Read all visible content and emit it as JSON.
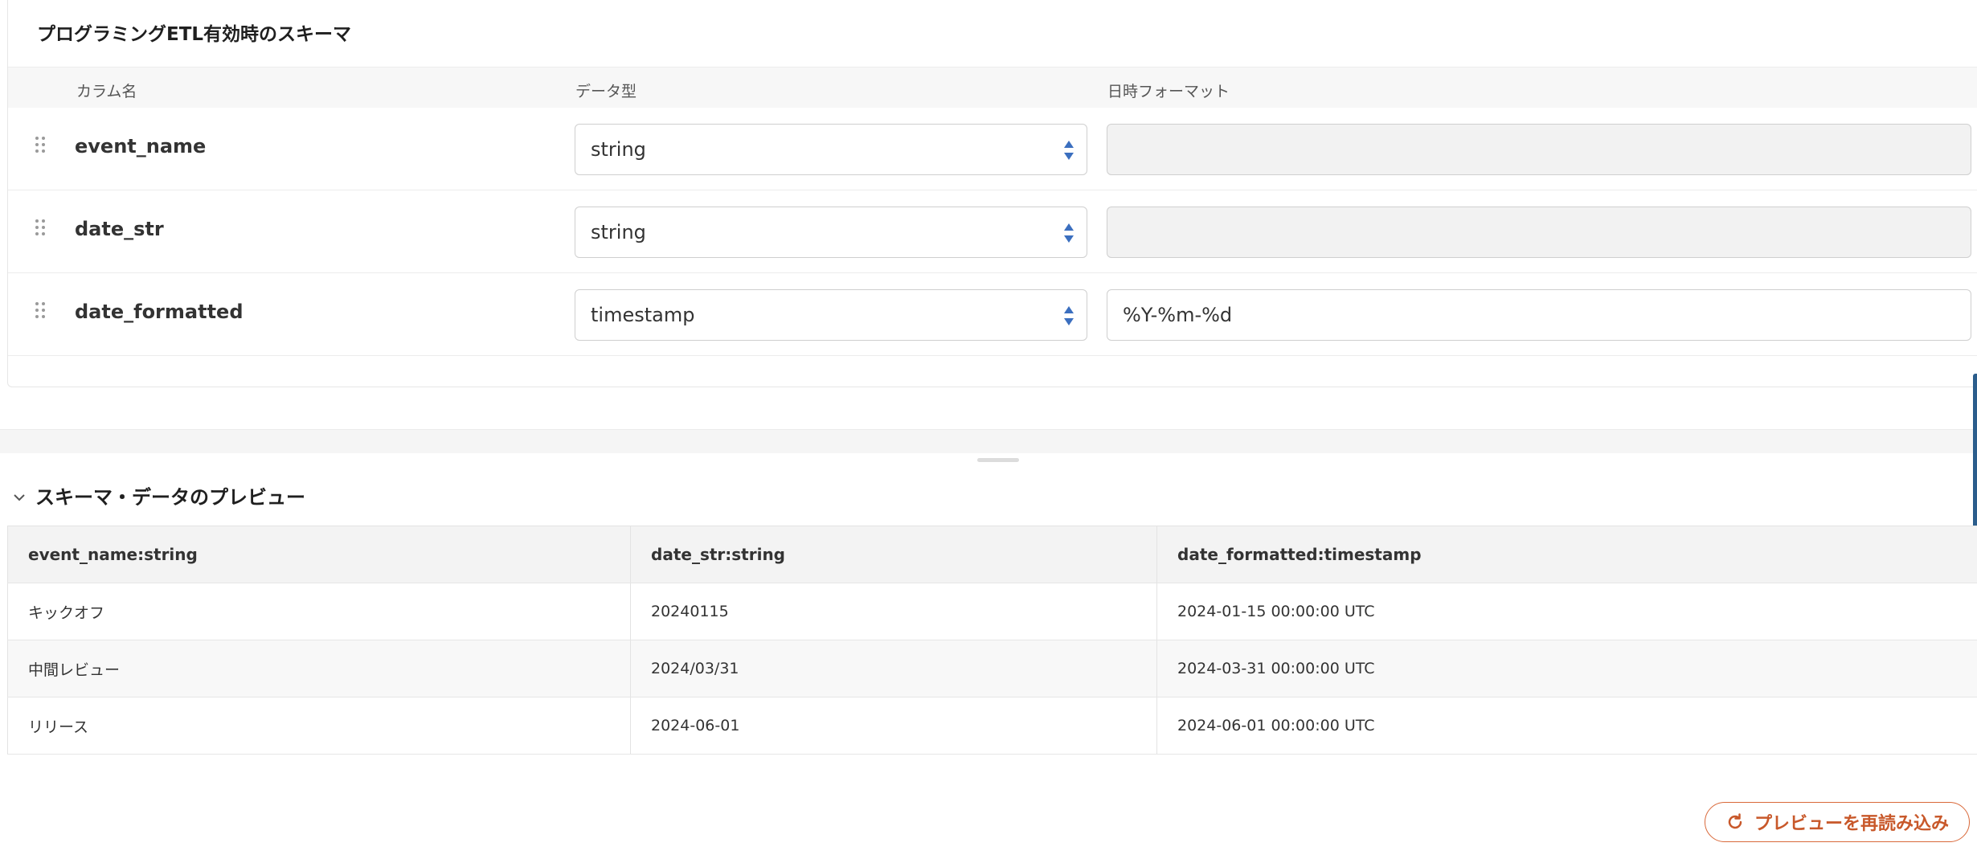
{
  "schema": {
    "title": "プログラミングETL有効時のスキーマ",
    "headers": {
      "column_name": "カラム名",
      "data_type": "データ型",
      "datetime_format": "日時フォーマット"
    },
    "rows": [
      {
        "name": "event_name",
        "type": "string",
        "format": "",
        "format_disabled": true
      },
      {
        "name": "date_str",
        "type": "string",
        "format": "",
        "format_disabled": true
      },
      {
        "name": "date_formatted",
        "type": "timestamp",
        "format": "%Y-%m-%d",
        "format_disabled": false
      }
    ]
  },
  "preview": {
    "title": "スキーマ・データのプレビュー",
    "columns": [
      "event_name:string",
      "date_str:string",
      "date_formatted:timestamp"
    ],
    "rows": [
      [
        "キックオフ",
        "20240115",
        "2024-01-15 00:00:00 UTC"
      ],
      [
        "中間レビュー",
        "2024/03/31",
        "2024-03-31 00:00:00 UTC"
      ],
      [
        "リリース",
        "2024-06-01",
        "2024-06-01 00:00:00 UTC"
      ]
    ],
    "reload_label": "プレビューを再読み込み"
  },
  "colors": {
    "accent": "#d9693a",
    "select_arrow": "#3b6fbf",
    "edge_bar": "#2b5d8c"
  },
  "icons": {
    "drag": "drag-handle-icon",
    "select": "select-arrows-icon",
    "collapse": "chevron-down-icon",
    "reload": "reload-icon"
  }
}
